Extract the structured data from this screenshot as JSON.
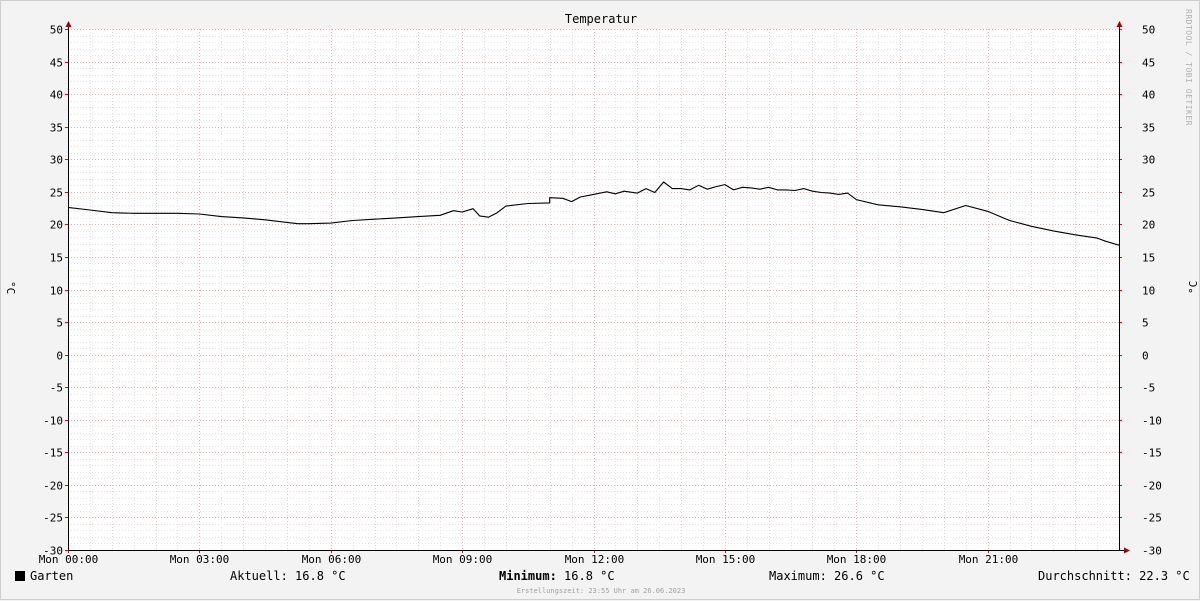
{
  "chart_data": {
    "type": "line",
    "title": "Temperatur",
    "ylabel": "°C",
    "ylim": [
      -30,
      50
    ],
    "yticks": [
      50,
      45,
      40,
      35,
      30,
      25,
      20,
      15,
      10,
      5,
      0,
      -5,
      -10,
      -15,
      -20,
      -25,
      -30
    ],
    "xlim": [
      0,
      24
    ],
    "xticks": [
      {
        "hour": 0,
        "label": "Mon 00:00"
      },
      {
        "hour": 3,
        "label": "Mon 03:00"
      },
      {
        "hour": 6,
        "label": "Mon 06:00"
      },
      {
        "hour": 9,
        "label": "Mon 09:00"
      },
      {
        "hour": 12,
        "label": "Mon 12:00"
      },
      {
        "hour": 15,
        "label": "Mon 15:00"
      },
      {
        "hour": 18,
        "label": "Mon 18:00"
      },
      {
        "hour": 21,
        "label": "Mon 21:00"
      }
    ],
    "grid": true,
    "series": [
      {
        "name": "Garten",
        "color": "#000000",
        "x": [
          0,
          0.5,
          1,
          1.5,
          2,
          2.5,
          3,
          3.5,
          4,
          4.5,
          5,
          5.25,
          5.5,
          6,
          6.5,
          7,
          7.5,
          8,
          8.5,
          8.8,
          9,
          9.25,
          9.4,
          9.6,
          9.8,
          10,
          10.5,
          11,
          11,
          11.3,
          11.5,
          11.7,
          12,
          12.3,
          12.5,
          12.7,
          13,
          13.2,
          13.4,
          13.6,
          13.8,
          14,
          14.2,
          14.4,
          14.6,
          14.8,
          15,
          15.2,
          15.4,
          15.6,
          15.8,
          16,
          16.2,
          16.4,
          16.6,
          16.8,
          17,
          17.2,
          17.4,
          17.6,
          17.8,
          18,
          18.5,
          19,
          19.5,
          20,
          20.5,
          21,
          21.5,
          22,
          22.5,
          23,
          23.5,
          23.7,
          24
        ],
        "y": [
          22.6,
          22.2,
          21.8,
          21.7,
          21.7,
          21.7,
          21.6,
          21.2,
          21.0,
          20.7,
          20.3,
          20.1,
          20.1,
          20.2,
          20.6,
          20.8,
          21.0,
          21.2,
          21.4,
          22.1,
          21.9,
          22.4,
          21.3,
          21.1,
          21.8,
          22.8,
          23.2,
          23.3,
          24.1,
          24.0,
          23.5,
          24.2,
          24.6,
          25.0,
          24.7,
          25.1,
          24.8,
          25.5,
          24.9,
          26.5,
          25.5,
          25.5,
          25.3,
          26.0,
          25.4,
          25.8,
          26.1,
          25.3,
          25.7,
          25.6,
          25.4,
          25.7,
          25.3,
          25.3,
          25.2,
          25.5,
          25.1,
          24.9,
          24.8,
          24.6,
          24.8,
          23.8,
          23.0,
          22.7,
          22.3,
          21.8,
          22.9,
          22.0,
          20.6,
          19.7,
          19.0,
          18.4,
          17.9,
          17.4,
          16.8
        ]
      }
    ]
  },
  "watermark": "RRDTOOL / TOBI OETIKER",
  "legend": {
    "series_name": "Garten",
    "aktuell": "Aktuell: 16.8 °C",
    "minimum_label": "Minimum:",
    "minimum_value": " 16.8 °C",
    "maximum": "Maximum: 26.6 °C",
    "durchschnitt": "Durchschnitt: 22.3 °C"
  },
  "footer": "Erstellungszeit: 23:55 Uhr am 26.06.2023"
}
